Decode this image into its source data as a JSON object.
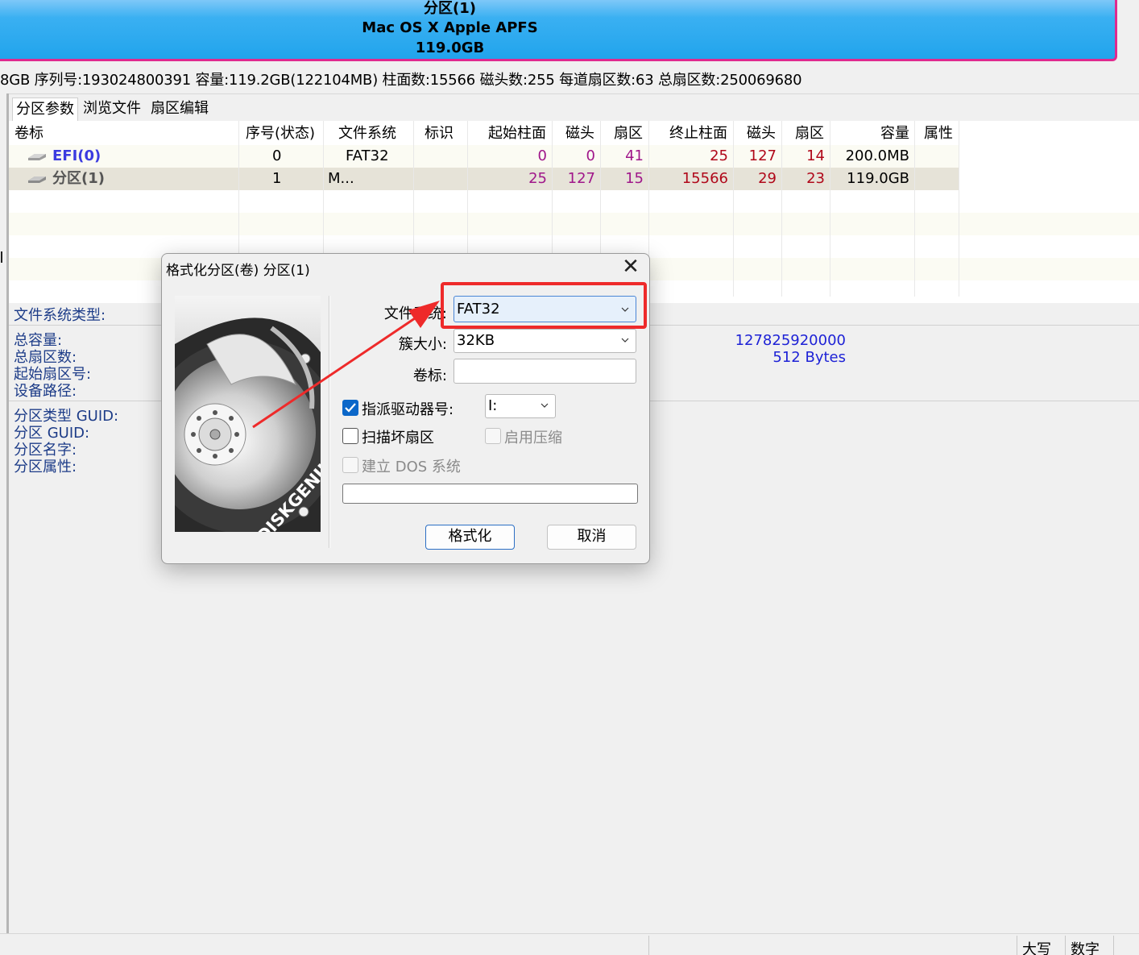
{
  "banner": {
    "name": "分区(1)",
    "fs": "Mac OS X Apple APFS",
    "size": "119.0GB"
  },
  "disk_info": "8GB  序列号:193024800391  容量:119.2GB(122104MB)  柱面数:15566  磁头数:255  每道扇区数:63  总扇区数:250069680",
  "tabs": [
    "分区参数",
    "浏览文件",
    "扇区编辑"
  ],
  "grid": {
    "headers": [
      "卷标",
      "序号(状态)",
      "文件系统",
      "标识",
      "起始柱面",
      "磁头",
      "扇区",
      "终止柱面",
      "磁头",
      "扇区",
      "容量",
      "属性"
    ],
    "rows": [
      {
        "name": "EFI(0)",
        "index": "0",
        "fs": "FAT32",
        "id": "",
        "start_cyl": "0",
        "start_head": "0",
        "start_sec": "41",
        "end_cyl": "25",
        "end_head": "127",
        "end_sec": "14",
        "size": "200.0MB",
        "attr": ""
      },
      {
        "name": "分区(1)",
        "index": "1",
        "fs": "M...",
        "id": "",
        "start_cyl": "25",
        "start_head": "127",
        "start_sec": "15",
        "end_cyl": "15566",
        "end_head": "29",
        "end_sec": "23",
        "size": "119.0GB",
        "attr": ""
      }
    ]
  },
  "details": {
    "fs_type_label": "文件系统类型:",
    "total_capacity_label": "总容量:",
    "total_sectors_label": "总扇区数:",
    "start_sector_label": "起始扇区号:",
    "device_path_label": "设备路径:",
    "bytes_value": "127825920000",
    "sector_size_value": "512 Bytes",
    "part_type_guid_label": "分区类型 GUID:",
    "part_guid_label": "分区 GUID:",
    "part_name_label": "分区名字:",
    "part_attr_label": "分区属性:"
  },
  "status_bar": {
    "caps": "大写",
    "num": "数字"
  },
  "dialog": {
    "title": "格式化分区(卷) 分区(1)",
    "close_glyph": "✕",
    "logo_text": "DISKGENIUS",
    "fs_label": "文件系统:",
    "fs_value": "FAT32",
    "cluster_label": "簇大小:",
    "cluster_value": "32KB",
    "volume_label": "卷标:",
    "volume_value": "",
    "assign_drive_label": "指派驱动器号:",
    "assign_drive_checked": true,
    "drive_letter": "I:",
    "scan_bad_label": "扫描坏扇区",
    "scan_bad_checked": false,
    "compress_label": "启用压缩",
    "compress_enabled": false,
    "dos_label": "建立 DOS 系统",
    "dos_enabled": false,
    "format_button": "格式化",
    "cancel_button": "取消"
  },
  "colors": {
    "highlight": "#ee2a2a",
    "banner_border": "#e02a8e",
    "banner_fill": "#21a4ec",
    "accent": "#0b67c9"
  }
}
